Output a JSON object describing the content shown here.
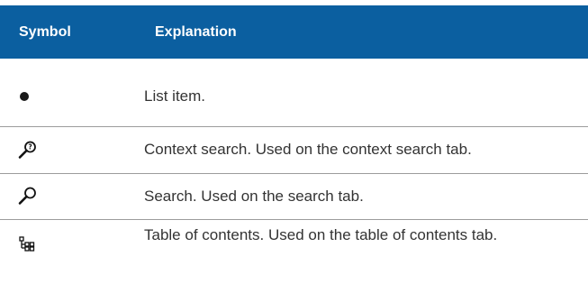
{
  "table": {
    "headers": {
      "symbol": "Symbol",
      "explanation": "Explanation"
    },
    "rows": [
      {
        "icon": "bullet-icon",
        "explanation": "List item."
      },
      {
        "icon": "context-search-icon",
        "explanation": "Context search. Used on the context search tab."
      },
      {
        "icon": "search-icon",
        "explanation": "Search. Used on the search tab."
      },
      {
        "icon": "table-of-contents-icon",
        "explanation": "Table of contents. Used on the table of contents tab."
      }
    ]
  },
  "colors": {
    "header_background": "#0b5fa0",
    "header_text": "#ffffff",
    "body_text": "#333333",
    "divider": "#9c9c9c"
  }
}
